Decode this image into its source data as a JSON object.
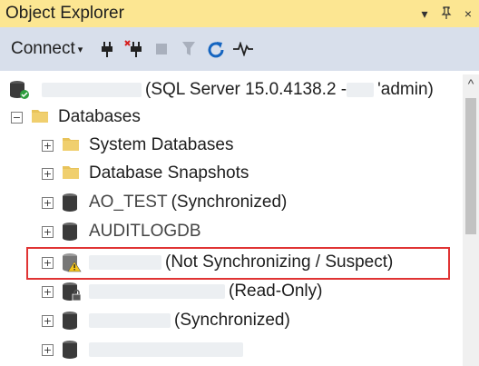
{
  "panel": {
    "title": "Object Explorer",
    "dropdown_glyph": "▾",
    "pin_glyph": "ᵖ",
    "close_glyph": "×"
  },
  "toolbar": {
    "connect_label": "Connect",
    "connect_caret": "▾",
    "tools": [
      "connect-icon",
      "disconnect-icon",
      "stop-icon",
      "filter-icon",
      "refresh-icon",
      "activity-monitor-icon"
    ]
  },
  "tree": {
    "server": {
      "label": "(SQL Server 15.0.4138.2 - ",
      "suffix": "'admin)",
      "icon": "server-icon"
    },
    "databases": {
      "label": "Databases",
      "expander": "−",
      "icon": "folder-icon"
    },
    "items": [
      {
        "label": "System Databases",
        "icon": "folder-icon",
        "expander": "+"
      },
      {
        "label": "Database Snapshots",
        "icon": "folder-icon",
        "expander": "+"
      },
      {
        "label": "(Synchronized)",
        "prefix": "AO_TEST",
        "icon": "database-icon",
        "expander": "+"
      },
      {
        "label": "AUDITLOGDB",
        "icon": "database-icon",
        "expander": "+"
      },
      {
        "label": "(Not Synchronizing / Suspect)",
        "icon": "database-warning-icon",
        "expander": "+"
      },
      {
        "label": "(Read-Only)",
        "icon": "database-lock-icon",
        "expander": "+"
      },
      {
        "label": "(Synchronized)",
        "icon": "database-icon",
        "expander": "+"
      },
      {
        "label": "",
        "icon": "database-icon",
        "expander": "+"
      }
    ]
  },
  "scrollbar": {
    "up_arrow": "^"
  },
  "colors": {
    "title_bar": "#fce692",
    "toolbar": "#d8dfeb",
    "highlight_border": "#e03434",
    "folder": "#e8c35a",
    "database": "#3a3a3a"
  }
}
